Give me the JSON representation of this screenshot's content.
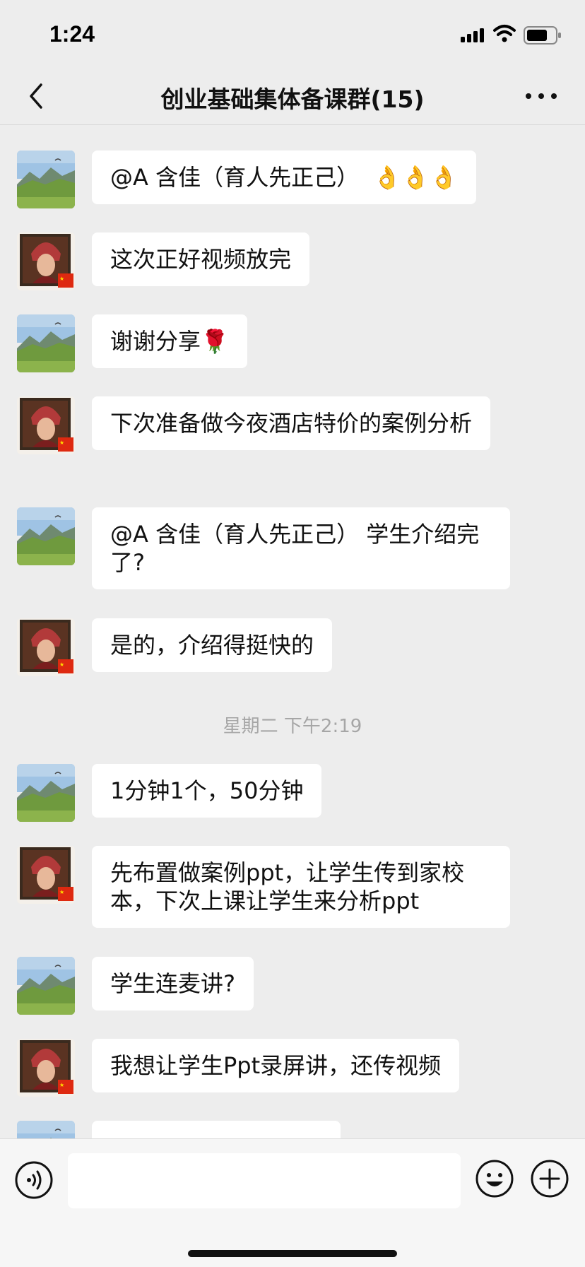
{
  "status_bar": {
    "time": "1:24"
  },
  "nav": {
    "title": "创业基础集体备课群(15)"
  },
  "messages": [
    {
      "sender": "landscape",
      "text": "@A 含佳（育人先正己）  👌👌👌"
    },
    {
      "sender": "portrait",
      "text": "这次正好视频放完"
    },
    {
      "sender": "landscape",
      "text": "谢谢分享🌹"
    },
    {
      "sender": "portrait",
      "text": "下次准备做今夜酒店特价的案例分析"
    },
    {
      "sender": "landscape",
      "text": "@A 含佳（育人先正己） 学生介绍完了?"
    },
    {
      "sender": "portrait",
      "text": "是的，介绍得挺快的"
    },
    {
      "sender": "landscape",
      "text": "1分钟1个，50分钟"
    },
    {
      "sender": "portrait",
      "text": "先布置做案例ppt，让学生传到家校本，下次上课让学生来分析ppt"
    },
    {
      "sender": "landscape",
      "text": "学生连麦讲?"
    },
    {
      "sender": "portrait",
      "text": "我想让学生Ppt录屏讲，还传视频"
    }
  ],
  "timestamp": "星期二 下午2:19",
  "colors": {
    "background": "#ededed",
    "bubble": "#ffffff",
    "text": "#111111",
    "timestamp": "#a6a6a6"
  },
  "icons": {
    "back": "chevron-left-icon",
    "more": "more-dots-icon",
    "voice": "voice-icon",
    "emoji": "emoji-icon",
    "plus": "plus-icon"
  }
}
